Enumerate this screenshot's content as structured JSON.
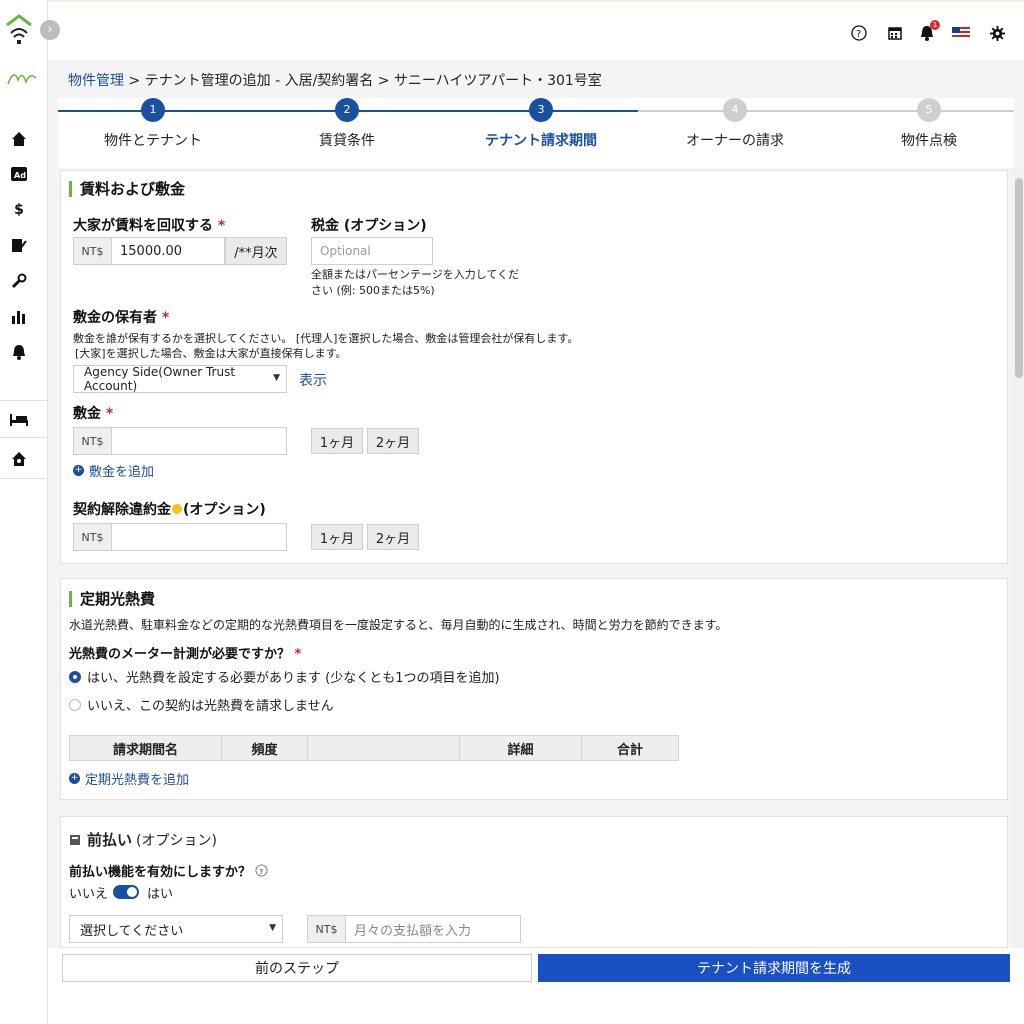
{
  "header": {
    "breadcrumb_link": "物件管理",
    "breadcrumb_rest": " > テナント管理の追加 - 入居/契約署名 > サニーハイツアパート・301号室",
    "bell_count": "1"
  },
  "steps": [
    {
      "num": "1",
      "label": "物件とテナント",
      "state": "done"
    },
    {
      "num": "2",
      "label": "賃貸条件",
      "state": "done"
    },
    {
      "num": "3",
      "label": "テナント請求期間",
      "state": "active"
    },
    {
      "num": "4",
      "label": "オーナーの請求",
      "state": "todo"
    },
    {
      "num": "5",
      "label": "物件点検",
      "state": "todo"
    }
  ],
  "rent": {
    "section_title": "賃料および敷金",
    "rent_label": "大家が賃料を回収する",
    "currency": "NT$",
    "rent_value": "15000.00",
    "rent_unit": "/**月次",
    "tax_label": "税金 (オプション)",
    "tax_placeholder": "Optional",
    "tax_help": "全額またはパーセンテージを入力してください (例: 500または5%)",
    "holder_label": "敷金の保有者",
    "holder_help_1": "敷金を誰が保有するかを選択してください。 [代理人]を選択した場合、敷金は管理会社が保有します。",
    "holder_help_2": "[大家]を選択した場合、敷金は大家が直接保有します。",
    "holder_value": "Agency Side(Owner Trust Account)",
    "show_link": "表示",
    "deposit_label": "敷金",
    "one_month": "1ヶ月",
    "two_month": "2ヶ月",
    "add_deposit": "敷金を追加",
    "penalty_label": "契約解除違約金",
    "penalty_optional": "(オプション)"
  },
  "utilities": {
    "section_title": "定期光熱費",
    "description": "水道光熱費、駐車料金などの定期的な光熱費項目を一度設定すると、毎月自動的に生成され、時間と労力を節約できます。",
    "meter_label": "光熱費のメーター計測が必要ですか？",
    "yes_option": "はい、光熱費を設定する必要があります (少なくとも1つの項目を追加)",
    "no_option": "いいえ、この契約は光熱費を請求しません",
    "columns": [
      "請求期間名",
      "頻度",
      "",
      "詳細",
      "合計"
    ],
    "add_utility": "定期光熱費を追加"
  },
  "prepay": {
    "section_title": "前払い",
    "section_optional": "(オプション)",
    "enable_label": "前払い機能を有効にしますか？",
    "no": "いいえ",
    "yes": "はい",
    "select_placeholder": "選択してください",
    "amount_placeholder": "月々の支払額を入力"
  },
  "footer": {
    "prev": "前のステップ",
    "generate": "テナント請求期間を生成"
  },
  "colors": {
    "primary": "#1b4fa0",
    "accent_green": "#6cb33f",
    "required": "#c62828"
  }
}
